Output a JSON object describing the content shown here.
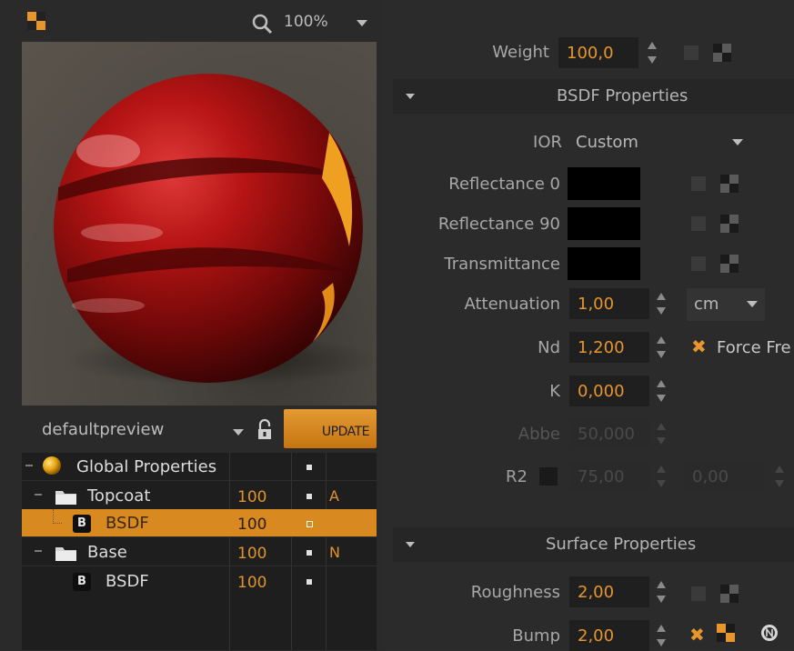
{
  "toolbar": {
    "zoom_value": "100%"
  },
  "preview": {
    "preset": "defaultpreview",
    "update_label": "UPDATE"
  },
  "tree": {
    "rows": [
      {
        "label": "Global Properties",
        "weight": "",
        "flag": ""
      },
      {
        "label": "Topcoat",
        "weight": "100",
        "flag": "A"
      },
      {
        "label": "BSDF",
        "weight": "100",
        "flag": "",
        "badge": "B",
        "selected": true
      },
      {
        "label": "Base",
        "weight": "100",
        "flag": "N"
      },
      {
        "label": "BSDF",
        "weight": "100",
        "flag": "",
        "badge": "B"
      }
    ]
  },
  "props": {
    "weight_label": "Weight",
    "weight_value": "100,0",
    "bsdf_section": "BSDF Properties",
    "ior_label": "IOR",
    "ior_value": "Custom",
    "reflectance0_label": "Reflectance 0",
    "reflectance90_label": "Reflectance 90",
    "transmittance_label": "Transmittance",
    "attenuation_label": "Attenuation",
    "attenuation_value": "1,00",
    "attenuation_unit": "cm",
    "nd_label": "Nd",
    "nd_value": "1,200",
    "force_label": "Force Fre",
    "k_label": "K",
    "k_value": "0,000",
    "abbe_label": "Abbe",
    "abbe_value": "50,000",
    "r2_label": "R2",
    "r2_value1": "75,00",
    "r2_value2": "0,00",
    "surface_section": "Surface Properties",
    "roughness_label": "Roughness",
    "roughness_value": "2,00",
    "bump_label": "Bump",
    "bump_value": "2,00"
  },
  "colors": {
    "accent": "#e6962c",
    "panel": "#2b2b2b",
    "selection": "#d8891f"
  }
}
